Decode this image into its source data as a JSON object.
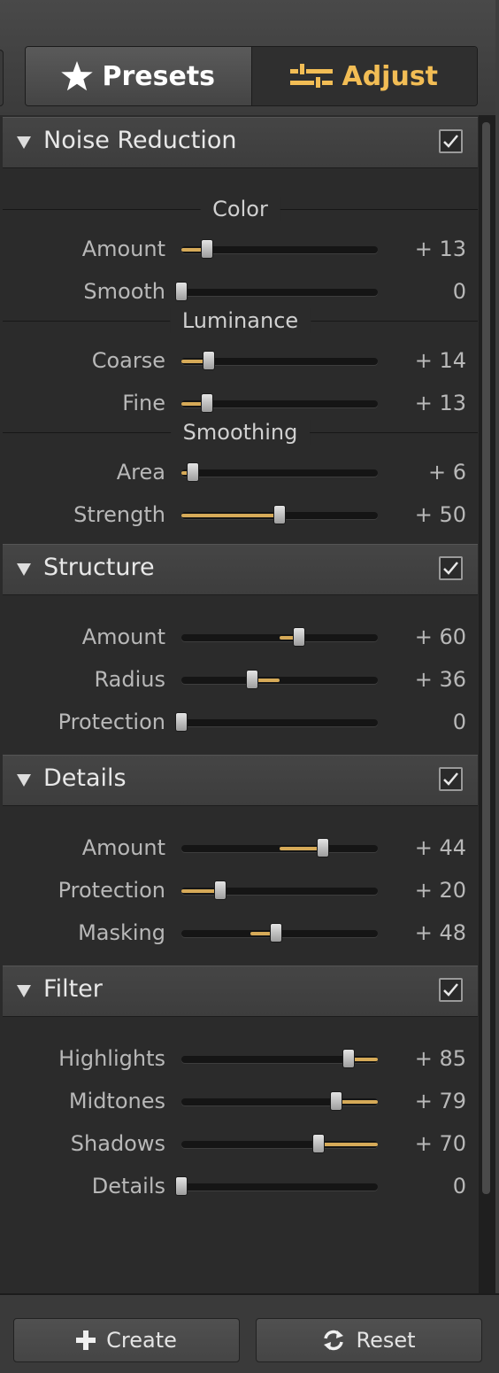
{
  "tabs": {
    "presets": "Presets",
    "adjust": "Adjust",
    "active": "adjust",
    "colors": {
      "accent": "#f2bd55",
      "inactive_text": "#ffffff"
    }
  },
  "sections": [
    {
      "title": "Noise Reduction",
      "checked": true,
      "groups": [
        {
          "label": "Color",
          "sliders": [
            {
              "label": "Amount",
              "value": "+ 13",
              "level": 13,
              "min": 0,
              "max": 100
            },
            {
              "label": "Smooth",
              "value": "0",
              "level": 0,
              "min": 0,
              "max": 100
            }
          ]
        },
        {
          "label": "Luminance",
          "sliders": [
            {
              "label": "Coarse",
              "value": "+ 14",
              "level": 14,
              "min": 0,
              "max": 100
            },
            {
              "label": "Fine",
              "value": "+ 13",
              "level": 13,
              "min": 0,
              "max": 100
            }
          ]
        },
        {
          "label": "Smoothing",
          "sliders": [
            {
              "label": "Area",
              "value": "+ 6",
              "level": 6,
              "min": 0,
              "max": 100
            },
            {
              "label": "Strength",
              "value": "+ 50",
              "level": 50,
              "min": 0,
              "max": 100
            }
          ]
        }
      ]
    },
    {
      "title": "Structure",
      "checked": true,
      "sliders": [
        {
          "label": "Amount",
          "value": "+ 60",
          "level": 60,
          "min": 0,
          "max": 100,
          "fill_from": 50
        },
        {
          "label": "Radius",
          "value": "+ 36",
          "level": 36,
          "min": 0,
          "max": 100,
          "fill_from": 50
        },
        {
          "label": "Protection",
          "value": "0",
          "level": 0,
          "min": 0,
          "max": 100
        }
      ]
    },
    {
      "title": "Details",
      "checked": true,
      "sliders": [
        {
          "label": "Amount",
          "value": "+ 44",
          "level": 72,
          "min": 0,
          "max": 100,
          "fill_from": 50
        },
        {
          "label": "Protection",
          "value": "+ 20",
          "level": 20,
          "min": 0,
          "max": 100
        },
        {
          "label": "Masking",
          "value": "+ 48",
          "level": 48,
          "min": 0,
          "max": 100,
          "fill_from": 35
        }
      ]
    },
    {
      "title": "Filter",
      "checked": true,
      "sliders": [
        {
          "label": "Highlights",
          "value": "+ 85",
          "level": 85,
          "min": 0,
          "max": 100,
          "fill_to": 100
        },
        {
          "label": "Midtones",
          "value": "+ 79",
          "level": 79,
          "min": 0,
          "max": 100,
          "fill_to": 100
        },
        {
          "label": "Shadows",
          "value": "+ 70",
          "level": 70,
          "min": 0,
          "max": 100,
          "fill_to": 100
        },
        {
          "label": "Details",
          "value": "0",
          "level": 0,
          "min": 0,
          "max": 100
        }
      ]
    }
  ],
  "footer": {
    "create": "Create",
    "reset": "Reset"
  },
  "icons": {
    "presets": "star-icon",
    "adjust": "sliders-icon",
    "collapse": "triangle-down-icon",
    "check": "checkmark-icon",
    "create": "plus-icon",
    "reset": "refresh-icon"
  }
}
